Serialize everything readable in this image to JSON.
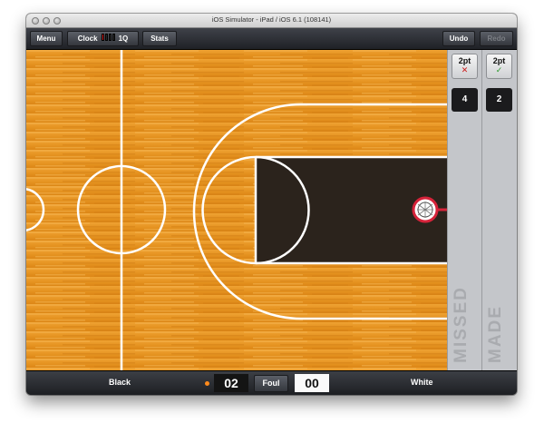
{
  "window": {
    "title": "iOS Simulator - iPad / iOS 6.1 (108141)"
  },
  "toolbar": {
    "menu_label": "Menu",
    "clock_label": "Clock",
    "period_label": "1Q",
    "stats_label": "Stats",
    "undo_label": "Undo",
    "redo_label": "Redo"
  },
  "missed_panel": {
    "shot_label": "2pt",
    "mark": "✕",
    "count": "4",
    "vertical_label": "MISSED"
  },
  "made_panel": {
    "shot_label": "2pt",
    "mark": "✓",
    "count": "2",
    "vertical_label": "MADE"
  },
  "bottom": {
    "home_team": "Black",
    "home_score": "02",
    "foul_label": "Foul",
    "away_score": "00",
    "away_team": "White"
  },
  "colors": {
    "wood": "#e6941f",
    "paint": "#2b231c",
    "lines": "#ffffff",
    "rim": "#d6233a",
    "possession": "#ff8a1c",
    "clock_on": "#d81d1d"
  }
}
